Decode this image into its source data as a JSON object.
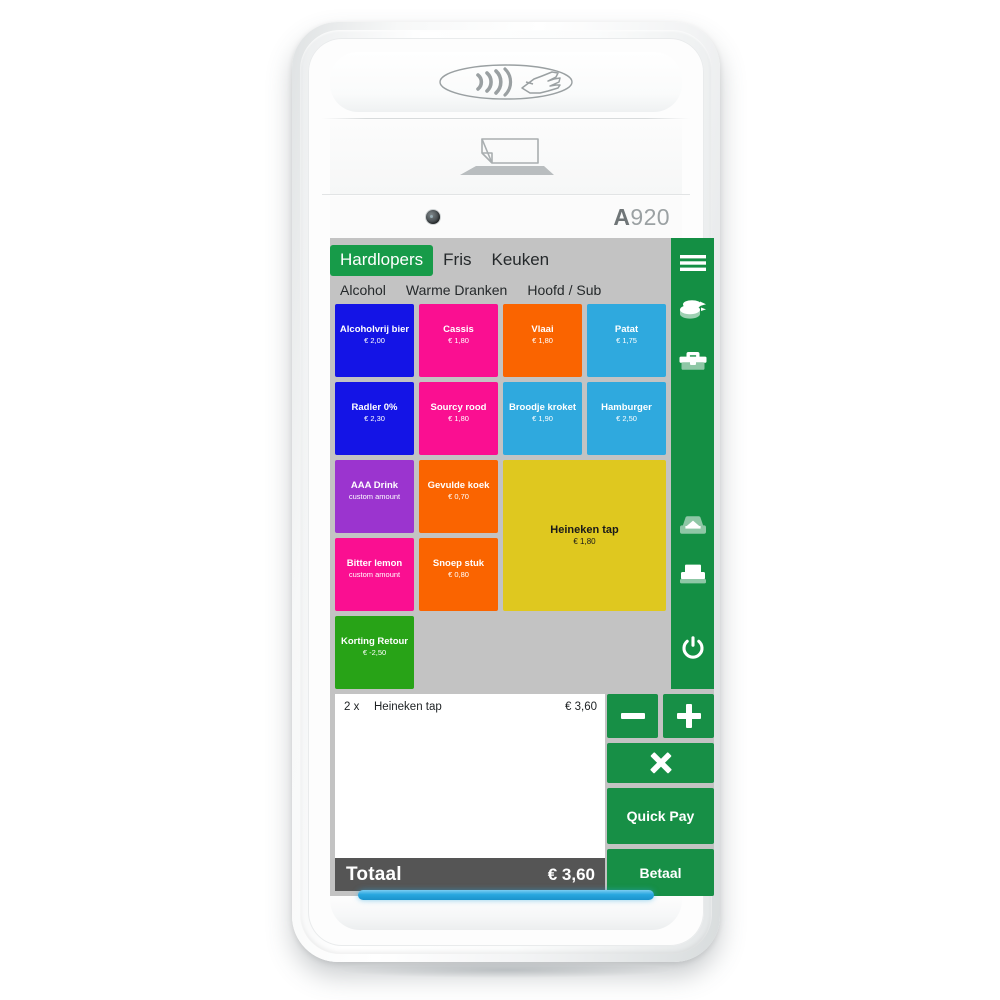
{
  "device": {
    "model_prefix": "A",
    "model_suffix": "920",
    "nfc_icon": "contactless-icon",
    "paper_icon": "paper-roll-icon",
    "camera": "camera-lens",
    "led": "status-led"
  },
  "tabs": {
    "primary": [
      {
        "label": "Hardlopers",
        "active": true
      },
      {
        "label": "Fris",
        "active": false
      },
      {
        "label": "Keuken",
        "active": false
      }
    ],
    "secondary": [
      {
        "label": "Alcohol"
      },
      {
        "label": "Warme Dranken"
      },
      {
        "label": "Hoofd / Sub"
      }
    ]
  },
  "products": [
    {
      "name": "Alcoholvrij bier",
      "price": "€ 2,00",
      "color": "#1414E6",
      "text": "light",
      "cols": 1,
      "rows": 1
    },
    {
      "name": "Cassis",
      "price": "€ 1,80",
      "color": "#FA0F91",
      "text": "light",
      "cols": 1,
      "rows": 1
    },
    {
      "name": "Vlaai",
      "price": "€ 1,80",
      "color": "#FA6400",
      "text": "light",
      "cols": 1,
      "rows": 1
    },
    {
      "name": "Patat",
      "price": "€ 1,75",
      "color": "#2FA9DE",
      "text": "light",
      "cols": 1,
      "rows": 1
    },
    {
      "name": "Radler 0%",
      "price": "€ 2,30",
      "color": "#1414E6",
      "text": "light",
      "cols": 1,
      "rows": 1
    },
    {
      "name": "Sourcy rood",
      "price": "€ 1,80",
      "color": "#FA0F91",
      "text": "light",
      "cols": 1,
      "rows": 1
    },
    {
      "name": "Broodje kroket",
      "price": "€ 1,90",
      "color": "#2FA9DE",
      "text": "light",
      "cols": 1,
      "rows": 1
    },
    {
      "name": "Hamburger",
      "price": "€ 2,50",
      "color": "#2FA9DE",
      "text": "light",
      "cols": 1,
      "rows": 1
    },
    {
      "name": "AAA Drink",
      "price": "custom amount",
      "color": "#9B34CF",
      "text": "light",
      "cols": 1,
      "rows": 1
    },
    {
      "name": "Gevulde koek",
      "price": "€ 0,70",
      "color": "#FA6400",
      "text": "light",
      "cols": 1,
      "rows": 1
    },
    {
      "name": "Heineken tap",
      "price": "€ 1,80",
      "color": "#DFC81F",
      "text": "dark",
      "cols": 2,
      "rows": 2
    },
    {
      "name": "Bitter lemon",
      "price": "custom amount",
      "color": "#FA0F91",
      "text": "light",
      "cols": 1,
      "rows": 1
    },
    {
      "name": "Snoep stuk",
      "price": "€ 0,80",
      "color": "#FA6400",
      "text": "light",
      "cols": 1,
      "rows": 1
    },
    {
      "name": "Korting Retour",
      "price": "€ -2,50",
      "color": "#28A317",
      "text": "light",
      "cols": 1,
      "rows": 1
    }
  ],
  "sidebar": {
    "background": "#148f44",
    "items": [
      {
        "icon": "hamburger-menu-icon",
        "name": "menu"
      },
      {
        "icon": "coins-icon",
        "name": "cash"
      },
      {
        "icon": "toolbox-icon",
        "name": "tools"
      },
      {
        "icon": "cash-drawer-icon",
        "name": "drawer"
      },
      {
        "icon": "printer-icon",
        "name": "printer"
      },
      {
        "icon": "power-icon",
        "name": "power"
      }
    ]
  },
  "cart": {
    "lines": [
      {
        "qty": "2 x",
        "description": "Heineken tap",
        "amount": "€ 3,60"
      }
    ],
    "total_label": "Totaal",
    "total_amount": "€ 3,60"
  },
  "actions": {
    "minus_icon": "minus-icon",
    "plus_icon": "plus-icon",
    "delete_icon": "close-x-icon",
    "quick_pay_label": "Quick Pay",
    "betaal_label": "Betaal"
  },
  "colors": {
    "brand_green": "#178F46",
    "sidebar_green": "#148f44",
    "screen_bg": "#c3c3c3",
    "total_bar": "#555555",
    "led_blue": "#29a8e0"
  }
}
